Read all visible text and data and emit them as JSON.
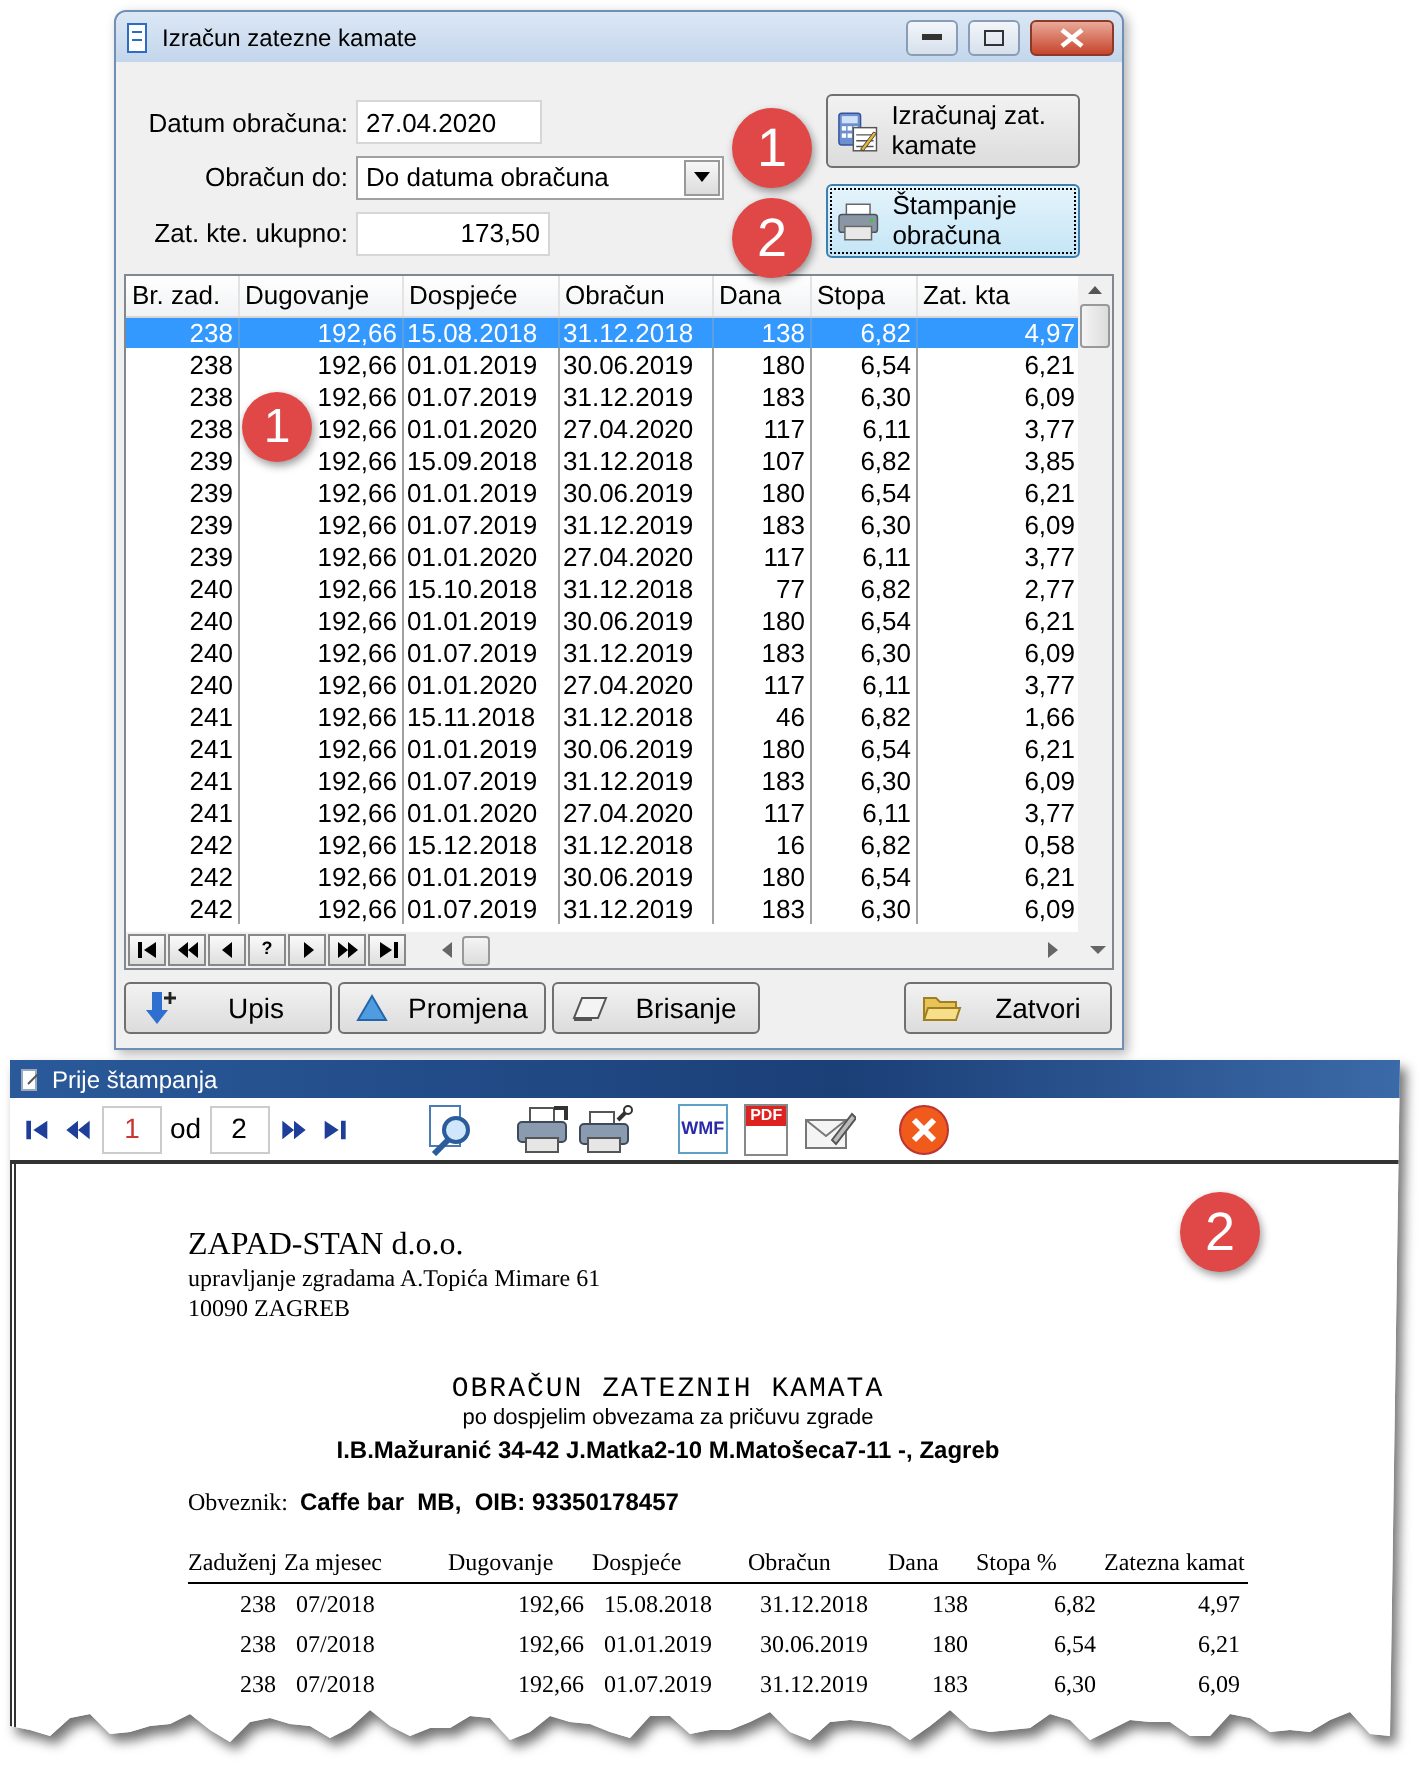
{
  "main_window": {
    "title": "Izračun zatezne kamate",
    "fields": [
      {
        "kind": "text",
        "label": "Datum obračuna:",
        "value": "27.04.2020"
      },
      {
        "kind": "combo",
        "label": "Obračun do:",
        "value": "Do datuma obračuna"
      },
      {
        "kind": "number",
        "label": "Zat. kte. ukupno:",
        "value": "173,50"
      }
    ],
    "action_buttons": [
      {
        "label": "Izračunaj zat. kamate",
        "focused": false
      },
      {
        "label": "Štampanje obračuna",
        "focused": true
      }
    ],
    "table": {
      "columns": [
        "Br. zad.",
        "Dugovanje",
        "Dospjeće",
        "Obračun",
        "Dana",
        "Stopa",
        "Zat. kta"
      ],
      "rows": [
        {
          "selected": true,
          "cells": [
            "238",
            "192,66",
            "15.08.2018",
            "31.12.2018",
            "138",
            "6,82",
            "4,97"
          ]
        },
        {
          "selected": false,
          "cells": [
            "238",
            "192,66",
            "01.01.2019",
            "30.06.2019",
            "180",
            "6,54",
            "6,21"
          ]
        },
        {
          "selected": false,
          "cells": [
            "238",
            "192,66",
            "01.07.2019",
            "31.12.2019",
            "183",
            "6,30",
            "6,09"
          ]
        },
        {
          "selected": false,
          "cells": [
            "238",
            "192,66",
            "01.01.2020",
            "27.04.2020",
            "117",
            "6,11",
            "3,77"
          ]
        },
        {
          "selected": false,
          "cells": [
            "239",
            "192,66",
            "15.09.2018",
            "31.12.2018",
            "107",
            "6,82",
            "3,85"
          ]
        },
        {
          "selected": false,
          "cells": [
            "239",
            "192,66",
            "01.01.2019",
            "30.06.2019",
            "180",
            "6,54",
            "6,21"
          ]
        },
        {
          "selected": false,
          "cells": [
            "239",
            "192,66",
            "01.07.2019",
            "31.12.2019",
            "183",
            "6,30",
            "6,09"
          ]
        },
        {
          "selected": false,
          "cells": [
            "239",
            "192,66",
            "01.01.2020",
            "27.04.2020",
            "117",
            "6,11",
            "3,77"
          ]
        },
        {
          "selected": false,
          "cells": [
            "240",
            "192,66",
            "15.10.2018",
            "31.12.2018",
            "77",
            "6,82",
            "2,77"
          ]
        },
        {
          "selected": false,
          "cells": [
            "240",
            "192,66",
            "01.01.2019",
            "30.06.2019",
            "180",
            "6,54",
            "6,21"
          ]
        },
        {
          "selected": false,
          "cells": [
            "240",
            "192,66",
            "01.07.2019",
            "31.12.2019",
            "183",
            "6,30",
            "6,09"
          ]
        },
        {
          "selected": false,
          "cells": [
            "240",
            "192,66",
            "01.01.2020",
            "27.04.2020",
            "117",
            "6,11",
            "3,77"
          ]
        },
        {
          "selected": false,
          "cells": [
            "241",
            "192,66",
            "15.11.2018",
            "31.12.2018",
            "46",
            "6,82",
            "1,66"
          ]
        },
        {
          "selected": false,
          "cells": [
            "241",
            "192,66",
            "01.01.2019",
            "30.06.2019",
            "180",
            "6,54",
            "6,21"
          ]
        },
        {
          "selected": false,
          "cells": [
            "241",
            "192,66",
            "01.07.2019",
            "31.12.2019",
            "183",
            "6,30",
            "6,09"
          ]
        },
        {
          "selected": false,
          "cells": [
            "241",
            "192,66",
            "01.01.2020",
            "27.04.2020",
            "117",
            "6,11",
            "3,77"
          ]
        },
        {
          "selected": false,
          "cells": [
            "242",
            "192,66",
            "15.12.2018",
            "31.12.2018",
            "16",
            "6,82",
            "0,58"
          ]
        },
        {
          "selected": false,
          "cells": [
            "242",
            "192,66",
            "01.01.2019",
            "30.06.2019",
            "180",
            "6,54",
            "6,21"
          ]
        },
        {
          "selected": false,
          "cells": [
            "242",
            "192,66",
            "01.07.2019",
            "31.12.2019",
            "183",
            "6,30",
            "6,09"
          ]
        }
      ]
    },
    "navigator": [
      {
        "kind": "first"
      },
      {
        "kind": "prev-page"
      },
      {
        "kind": "prev"
      },
      {
        "kind": "text",
        "label": "?"
      },
      {
        "kind": "next"
      },
      {
        "kind": "next-page"
      },
      {
        "kind": "last"
      }
    ],
    "bottom_buttons": [
      {
        "label": "Upis"
      },
      {
        "label": "Promjena"
      },
      {
        "label": "Brisanje"
      },
      {
        "label": "Zatvori"
      }
    ],
    "callouts": [
      {
        "label": "1"
      },
      {
        "label": "2"
      },
      {
        "label": "1"
      }
    ]
  },
  "preview_window": {
    "title": "Prije štampanja",
    "page": "1",
    "of_label": "od",
    "page_count": "2",
    "tools": [
      {
        "kind": "zoom"
      },
      {
        "kind": "print"
      },
      {
        "kind": "print-setup"
      },
      {
        "kind": "export",
        "label": "WMF"
      },
      {
        "kind": "pdf",
        "label": "PDF"
      },
      {
        "kind": "email"
      },
      {
        "kind": "close"
      }
    ],
    "callouts": [
      {
        "label": "2"
      }
    ],
    "report": {
      "company": "ZAPAD-STAN d.o.o.",
      "company_lines": [
        "upravljanje zgradama A.Topića Mimare 61",
        "10090 ZAGREB"
      ],
      "title": "OBRAČUN ZATEZNIH KAMATA",
      "subtitle": "po dospjelim obvezama za pričuvu zgrade",
      "address": "I.B.Mažuranić 34-42 J.Matka2-10 M.Matošeca7-11 -, Zagreb",
      "obligor_label": "Obveznik:",
      "obligor": "Caffe bar  MB,  OIB: 93350178457",
      "columns": [
        "Zaduženj",
        "Za mjesec",
        "Dugovanje",
        "Dospjeće",
        "Obračun",
        "Dana",
        "Stopa %",
        "Zatezna kamat"
      ],
      "rows": [
        [
          "238",
          "07/2018",
          "192,66",
          "15.08.2018",
          "31.12.2018",
          "138",
          "6,82",
          "4,97"
        ],
        [
          "238",
          "07/2018",
          "192,66",
          "01.01.2019",
          "30.06.2019",
          "180",
          "6,54",
          "6,21"
        ],
        [
          "238",
          "07/2018",
          "192,66",
          "01.07.2019",
          "31.12.2019",
          "183",
          "6,30",
          "6,09"
        ]
      ]
    }
  }
}
